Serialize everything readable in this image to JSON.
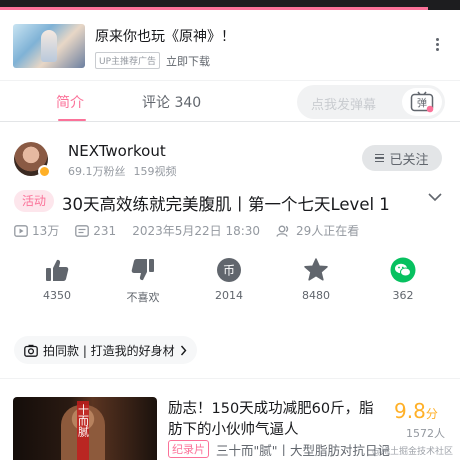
{
  "colors": {
    "accent": "#fb7299",
    "gold": "#ffb027",
    "text": "#18191c",
    "muted": "#9499a0",
    "wechat": "#07c160"
  },
  "player": {
    "progress": 0.93
  },
  "ad": {
    "title": "原来你也玩《原神》！",
    "tag": "UP主推荐广告",
    "link": "立即下载",
    "icons": {
      "more": "more-vertical-icon"
    }
  },
  "tabs": [
    {
      "label": "简介",
      "active": true
    },
    {
      "label": "评论 340",
      "active": false
    }
  ],
  "danmaku": {
    "placeholder": "点我发弹幕",
    "icon": "danmaku-toggle-icon",
    "button_char": "弹"
  },
  "uploader": {
    "name": "NEXTworkout",
    "fans": "69.1万粉丝",
    "videos": "159视频",
    "follow_label": "已关注"
  },
  "video": {
    "badge": "活动",
    "title": "30天高效练就完美腹肌丨第一个七天Level 1",
    "views": "13万",
    "danmaku_count": "231",
    "date": "2023年5月22日 18:30",
    "watching": "29人正在看"
  },
  "actions": [
    {
      "id": "like",
      "icon": "thumbs-up-icon",
      "value": "4350"
    },
    {
      "id": "dislike",
      "icon": "thumbs-down-icon",
      "value": "不喜欢"
    },
    {
      "id": "coin",
      "icon": "coin-icon",
      "value": "2014",
      "glyph": "币"
    },
    {
      "id": "favorite",
      "icon": "star-icon",
      "value": "8480"
    },
    {
      "id": "share",
      "icon": "wechat-icon",
      "value": "362"
    }
  ],
  "shop": {
    "label": "拍同款 | 打造我的好身材"
  },
  "recommendation": {
    "title": "励志！150天成功减肥60斤，脂肪下的小伙帅气逼人",
    "score": "9.8",
    "score_unit": "分",
    "rating_count": "1572人",
    "tag": "纪录片",
    "desc": "三十而\"腻\"丨大型脂肪对抗日记",
    "thumb_text": "三十而腻"
  },
  "watermark": "@稀土掘金技术社区"
}
